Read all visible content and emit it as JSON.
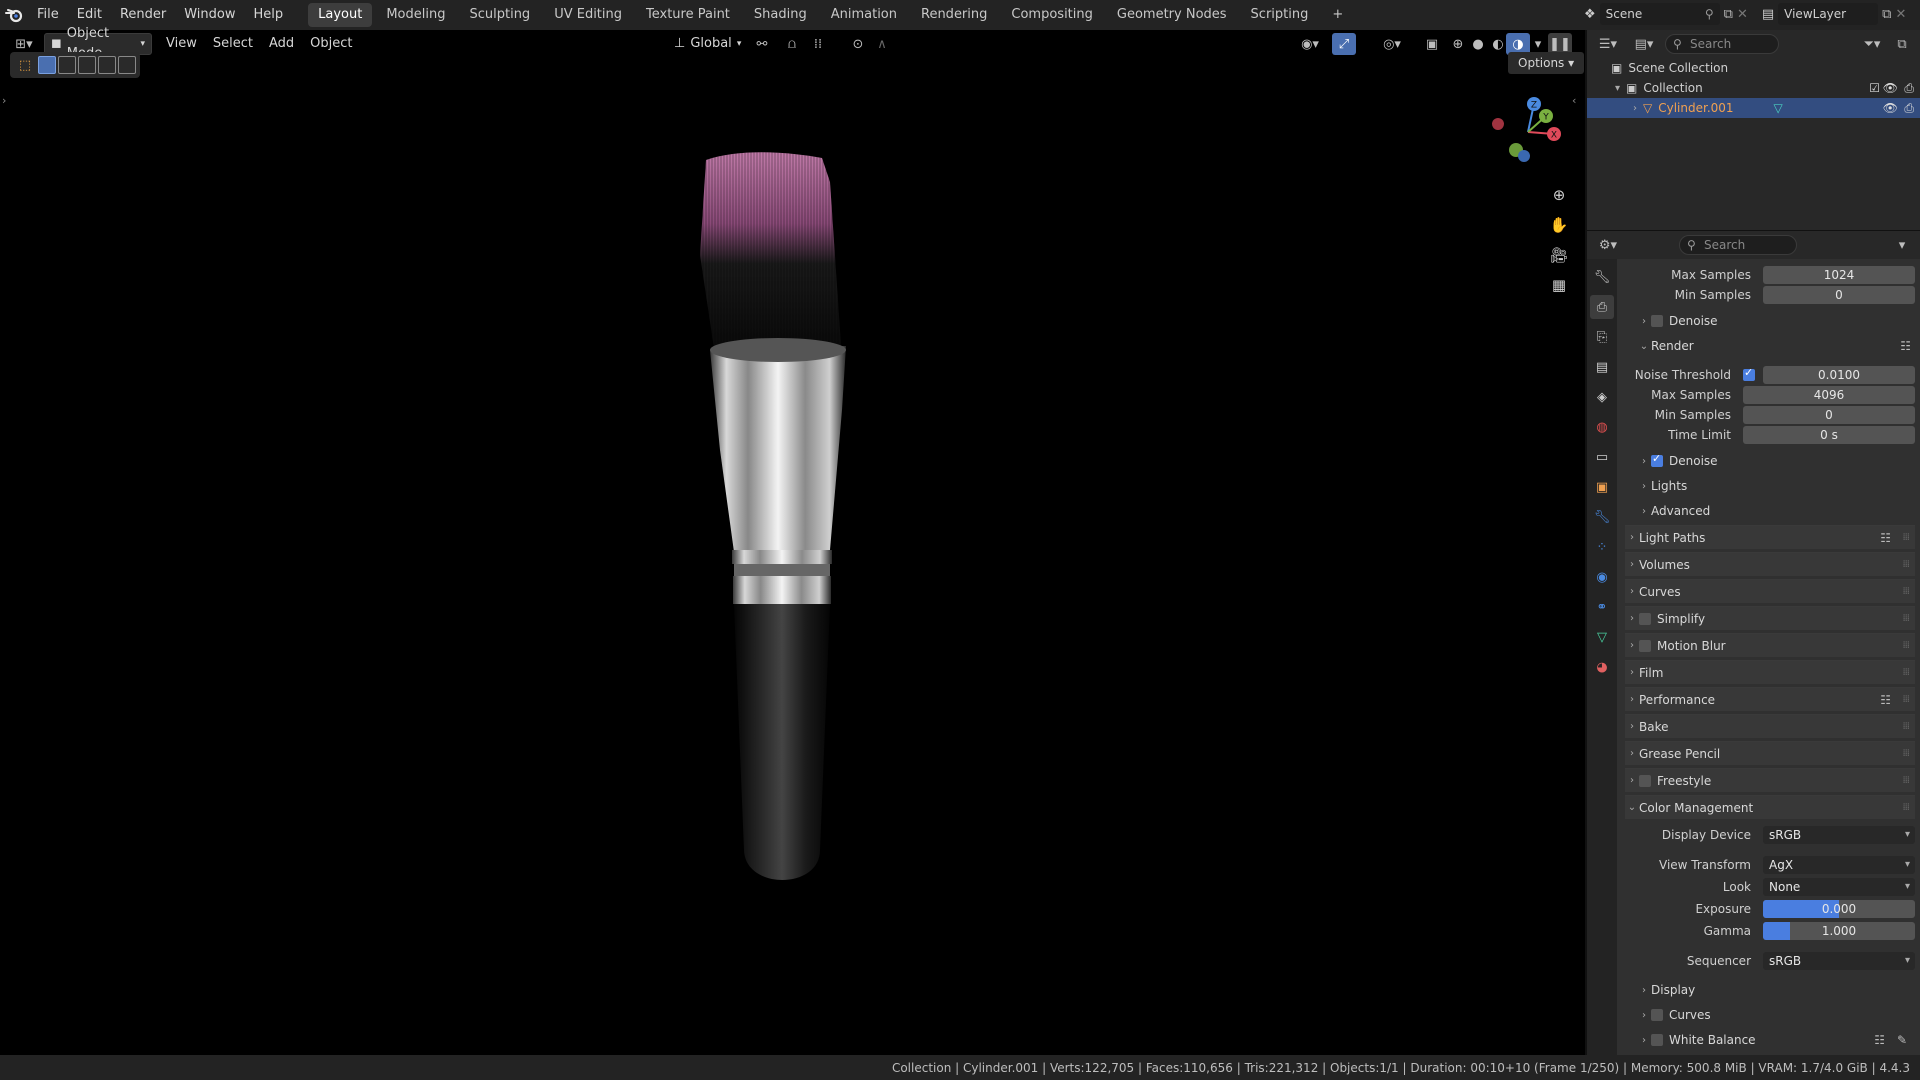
{
  "topbar": {
    "menus": [
      "File",
      "Edit",
      "Render",
      "Window",
      "Help"
    ],
    "workspaces": [
      "Layout",
      "Modeling",
      "Sculpting",
      "UV Editing",
      "Texture Paint",
      "Shading",
      "Animation",
      "Rendering",
      "Compositing",
      "Geometry Nodes",
      "Scripting"
    ],
    "active_workspace": "Layout",
    "add_tab": "+",
    "scene_name": "Scene",
    "view_layer": "ViewLayer"
  },
  "viewport": {
    "mode": "Object Mode",
    "menus": [
      "View",
      "Select",
      "Add",
      "Object"
    ],
    "transform": "Global",
    "options": "Options"
  },
  "outliner": {
    "search_placeholder": "Search",
    "scene_collection": "Scene Collection",
    "collection": "Collection",
    "object": "Cylinder.001"
  },
  "properties": {
    "search_placeholder": "Search",
    "viewport_max_samples_label": "Max Samples",
    "viewport_max_samples": "1024",
    "viewport_min_samples_label": "Min Samples",
    "viewport_min_samples": "0",
    "denoise_1": "Denoise",
    "render_section": "Render",
    "noise_threshold_label": "Noise Threshold",
    "noise_threshold": "0.0100",
    "render_max_samples_label": "Max Samples",
    "render_max_samples": "4096",
    "render_min_samples_label": "Min Samples",
    "render_min_samples": "0",
    "time_limit_label": "Time Limit",
    "time_limit": "0 s",
    "denoise_2": "Denoise",
    "lights": "Lights",
    "advanced": "Advanced",
    "sections": [
      "Light Paths",
      "Volumes",
      "Curves",
      "Simplify",
      "Motion Blur",
      "Film",
      "Performance",
      "Bake",
      "Grease Pencil",
      "Freestyle"
    ],
    "color_management": "Color Management",
    "display_device_label": "Display Device",
    "display_device": "sRGB",
    "view_transform_label": "View Transform",
    "view_transform": "AgX",
    "look_label": "Look",
    "look": "None",
    "exposure_label": "Exposure",
    "exposure": "0.000",
    "exposure_fill": 0.5,
    "gamma_label": "Gamma",
    "gamma": "1.000",
    "gamma_fill": 0.18,
    "sequencer_label": "Sequencer",
    "sequencer": "sRGB",
    "display": "Display",
    "curves_sub": "Curves",
    "white_balance": "White Balance"
  },
  "statusbar": {
    "text": "Collection | Cylinder.001 | Verts:122,705 | Faces:110,656 | Tris:221,312 | Objects:1/1 | Duration: 00:10+10 (Frame 1/250) | Memory: 500.8 MiB | VRAM: 1.7/4.0 GiB | 4.4.3"
  },
  "gizmo": {
    "x": "X",
    "y": "Y",
    "z": "Z"
  },
  "colors": {
    "accent": "#4a7ee0",
    "selected_row": "#334d80",
    "object_orange": "#f0a050"
  }
}
